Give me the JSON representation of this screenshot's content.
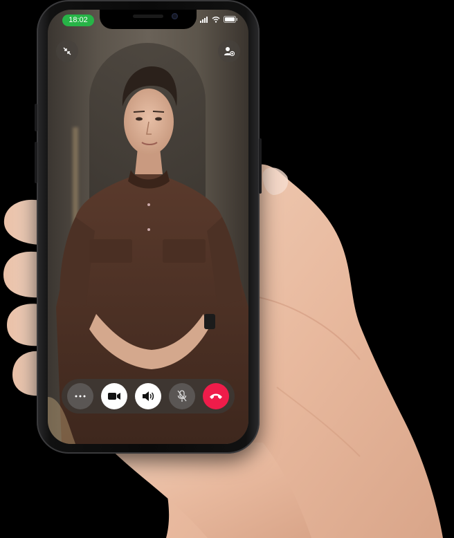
{
  "status_bar": {
    "time": "18:02",
    "signal_icon": "cellular-signal-icon",
    "wifi_icon": "wifi-icon",
    "battery_icon": "battery-icon"
  },
  "top_controls": {
    "left_icon": "minimize-arrows-icon",
    "right_icon": "add-participant-icon"
  },
  "call_controls": [
    {
      "name": "more-options-button",
      "icon": "ellipsis-icon"
    },
    {
      "name": "camera-toggle-button",
      "icon": "video-camera-icon"
    },
    {
      "name": "speaker-toggle-button",
      "icon": "speaker-icon"
    },
    {
      "name": "mute-toggle-button",
      "icon": "microphone-muted-icon"
    },
    {
      "name": "end-call-button",
      "icon": "end-call-icon"
    }
  ],
  "colors": {
    "time_pill": "#27b447",
    "end_call": "#ef1c4a",
    "controls_bar": "#3c3a38"
  }
}
